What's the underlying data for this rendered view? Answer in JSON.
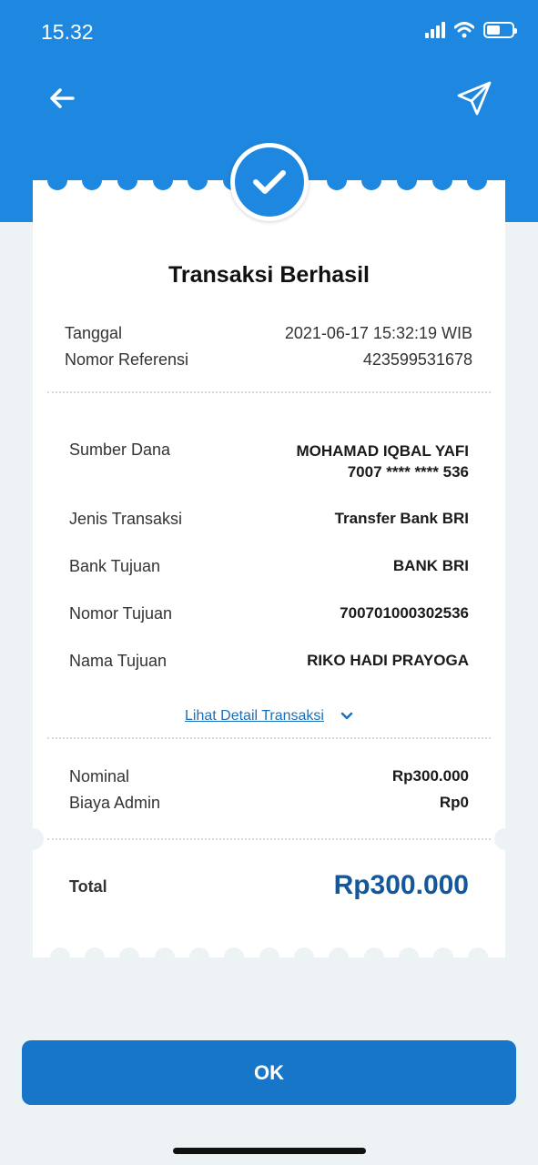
{
  "status_bar": {
    "time": "15.32",
    "icons": [
      "signal-icon",
      "wifi-icon",
      "battery-icon"
    ]
  },
  "header": {
    "back_icon": "arrow-left-icon",
    "share_icon": "paper-plane-icon"
  },
  "receipt": {
    "status_icon": "checkmark-icon",
    "title": "Transaksi Berhasil",
    "meta": [
      {
        "label": "Tanggal",
        "value": "2021-06-17 15:32:19 WIB"
      },
      {
        "label": "Nomor Referensi",
        "value": "423599531678"
      }
    ],
    "details": [
      {
        "label": "Sumber Dana",
        "value": "MOHAMAD IQBAL YAFI",
        "value2": "7007 **** **** 536"
      },
      {
        "label": "Jenis Transaksi",
        "value": "Transfer Bank BRI"
      },
      {
        "label": "Bank Tujuan",
        "value": "BANK BRI"
      },
      {
        "label": "Nomor Tujuan",
        "value": "700701000302536"
      },
      {
        "label": "Nama Tujuan",
        "value": "RIKO HADI PRAYOGA"
      }
    ],
    "detail_link": "Lihat Detail Transaksi",
    "amounts": [
      {
        "label": "Nominal",
        "value": "Rp300.000"
      },
      {
        "label": "Biaya Admin",
        "value": "Rp0"
      }
    ],
    "total_label": "Total",
    "total_value": "Rp300.000"
  },
  "ok_button": "OK",
  "colors": {
    "primary": "#1e88e0",
    "button": "#1776c8",
    "total": "#14579a",
    "link": "#1a6fb8",
    "background": "#edf2f5"
  }
}
